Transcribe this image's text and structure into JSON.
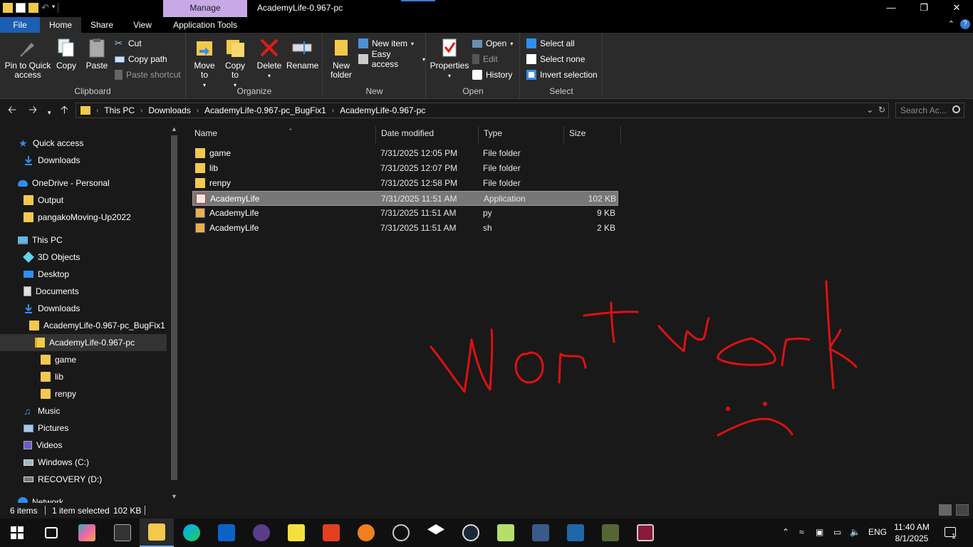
{
  "window": {
    "title": "AcademyLife-0.967-pc",
    "manage_tab": "Manage"
  },
  "ribbon_tabs": [
    "File",
    "Home",
    "Share",
    "View",
    "Application Tools"
  ],
  "ribbon": {
    "clipboard": {
      "label": "Clipboard",
      "pin": "Pin to Quick access",
      "copy": "Copy",
      "paste": "Paste",
      "cut": "Cut",
      "copy_path": "Copy path",
      "paste_shortcut": "Paste shortcut"
    },
    "organize": {
      "label": "Organize",
      "move_to": "Move to",
      "copy_to": "Copy to",
      "delete": "Delete",
      "rename": "Rename"
    },
    "new": {
      "label": "New",
      "new_folder": "New folder",
      "new_item": "New item",
      "easy_access": "Easy access"
    },
    "open": {
      "label": "Open",
      "properties": "Properties",
      "open": "Open",
      "edit": "Edit",
      "history": "History"
    },
    "select": {
      "label": "Select",
      "select_all": "Select all",
      "select_none": "Select none",
      "invert_selection": "Invert selection"
    }
  },
  "address": {
    "crumbs": [
      "This PC",
      "Downloads",
      "AcademyLife-0.967-pc_BugFix1",
      "AcademyLife-0.967-pc"
    ],
    "search_placeholder": "Search Ac..."
  },
  "nav": {
    "items": [
      {
        "label": "Quick access",
        "icon": "star-icon"
      },
      {
        "label": "Downloads",
        "icon": "download-icon"
      },
      {
        "label": "OneDrive - Personal",
        "icon": "cloud-icon"
      },
      {
        "label": "Output",
        "icon": "folder-icon"
      },
      {
        "label": "pangakoMoving-Up2022",
        "icon": "folder-icon"
      },
      {
        "label": "This PC",
        "icon": "pc-icon"
      },
      {
        "label": "3D Objects",
        "icon": "cube-icon"
      },
      {
        "label": "Desktop",
        "icon": "desktop-icon"
      },
      {
        "label": "Documents",
        "icon": "documents-icon"
      },
      {
        "label": "Downloads",
        "icon": "download-icon"
      },
      {
        "label": "AcademyLife-0.967-pc_BugFix1",
        "icon": "folder-icon"
      },
      {
        "label": "AcademyLife-0.967-pc",
        "icon": "folder-icon"
      },
      {
        "label": "game",
        "icon": "folder-icon"
      },
      {
        "label": "lib",
        "icon": "folder-icon"
      },
      {
        "label": "renpy",
        "icon": "folder-icon"
      },
      {
        "label": "Music",
        "icon": "music-icon"
      },
      {
        "label": "Pictures",
        "icon": "pictures-icon"
      },
      {
        "label": "Videos",
        "icon": "videos-icon"
      },
      {
        "label": "Windows (C:)",
        "icon": "drive-icon"
      },
      {
        "label": "RECOVERY (D:)",
        "icon": "drive-icon"
      },
      {
        "label": "Network",
        "icon": "network-icon"
      }
    ]
  },
  "columns": {
    "name": "Name",
    "date": "Date modified",
    "type": "Type",
    "size": "Size"
  },
  "files": [
    {
      "name": "game",
      "date": "7/31/2025 12:05 PM",
      "type": "File folder",
      "size": "",
      "icon": "folder-icon"
    },
    {
      "name": "lib",
      "date": "7/31/2025 12:07 PM",
      "type": "File folder",
      "size": "",
      "icon": "folder-icon"
    },
    {
      "name": "renpy",
      "date": "7/31/2025 12:58 PM",
      "type": "File folder",
      "size": "",
      "icon": "folder-icon"
    },
    {
      "name": "AcademyLife",
      "date": "7/31/2025 11:51 AM",
      "type": "Application",
      "size": "102 KB",
      "icon": "app-icon"
    },
    {
      "name": "AcademyLife",
      "date": "7/31/2025 11:51 AM",
      "type": "py",
      "size": "9 KB",
      "icon": "py-file-icon"
    },
    {
      "name": "AcademyLife",
      "date": "7/31/2025 11:51 AM",
      "type": "sh",
      "size": "2 KB",
      "icon": "sh-file-icon"
    }
  ],
  "annotation": {
    "handwritten_text": "Wont work",
    "color": "#e01010"
  },
  "status": {
    "items": "6 items",
    "selected": "1 item selected",
    "selected_size": "102 KB"
  },
  "taskbar": {
    "language": "ENG",
    "time": "11:40 AM",
    "date": "8/1/2025",
    "notification_count": "1"
  },
  "colors": {
    "accent": "#1a5fb4",
    "manage_tab": "#c7a9e8",
    "folder": "#f2c94c",
    "background": "#191919"
  }
}
